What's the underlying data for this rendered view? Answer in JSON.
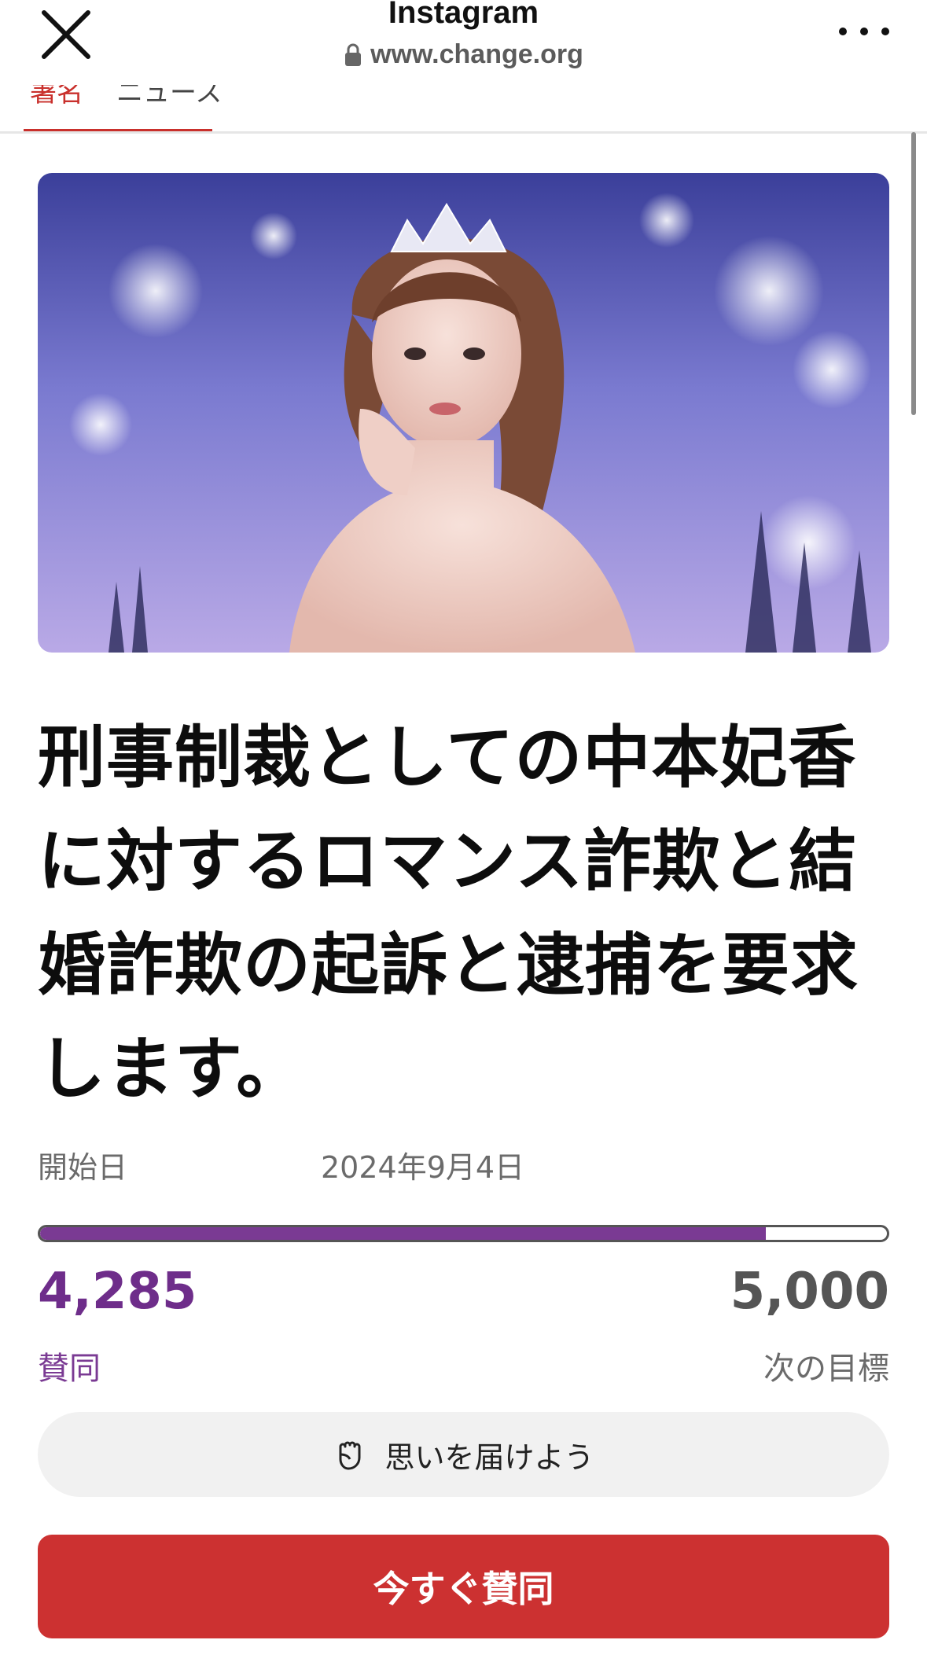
{
  "browser": {
    "title": "Instagram",
    "url": "www.change.org"
  },
  "tabs": {
    "partial_text": [
      "署名",
      "ニュース"
    ]
  },
  "petition": {
    "title": "刑事制裁としての中本妃香に対するロマンス詐欺と結婚詐欺の起訴と逮捕を要求します。",
    "start_label": "開始日",
    "start_date": "2024年9月4日",
    "progress": 0.857,
    "supporters_count": "4,285",
    "supporters_label": "賛同",
    "goal_count": "5,000",
    "goal_label": "次の目標",
    "share_label": "思いを届けよう",
    "sign_label": "今すぐ賛同"
  },
  "colors": {
    "accent_red": "#cc3131",
    "accent_purple": "#7a3a93"
  }
}
